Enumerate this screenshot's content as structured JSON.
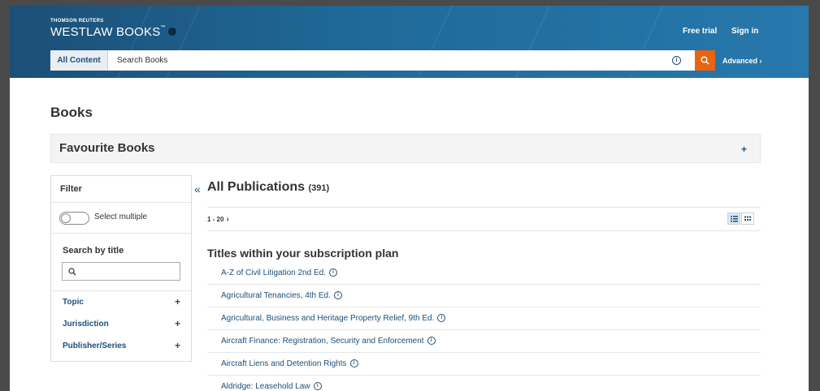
{
  "header": {
    "brand_small": "THOMSON REUTERS",
    "brand_main": "WESTLAW BOOKS",
    "brand_tm": "™",
    "free_trial": "Free trial",
    "sign_in": "Sign in",
    "search_scope": "All Content",
    "search_placeholder": "Search Books",
    "advanced": "Advanced ›"
  },
  "page": {
    "title": "Books"
  },
  "favourites": {
    "title": "Favourite Books"
  },
  "filter": {
    "title": "Filter",
    "toggle_label": "Select multiple",
    "search_by_title": "Search by title",
    "facets": [
      {
        "label": "Topic"
      },
      {
        "label": "Jurisdiction"
      },
      {
        "label": "Publisher/Series"
      }
    ]
  },
  "publications": {
    "title": "All Publications",
    "count": "(391)",
    "pager": "1 - 20",
    "section_title": "Titles within your subscription plan",
    "items": [
      {
        "title": "A-Z of Civil Litigation 2nd Ed."
      },
      {
        "title": "Agricultural Tenancies, 4th Ed."
      },
      {
        "title": "Agricultural, Business and Heritage Property Relief, 9th Ed."
      },
      {
        "title": "Aircraft Finance: Registration, Security and Enforcement"
      },
      {
        "title": "Aircraft Liens and Detention Rights"
      },
      {
        "title": "Aldridge: Leasehold Law"
      }
    ]
  },
  "colors": {
    "header": "#1f6a99",
    "accent": "#e56513",
    "link": "#1d4f7a"
  }
}
